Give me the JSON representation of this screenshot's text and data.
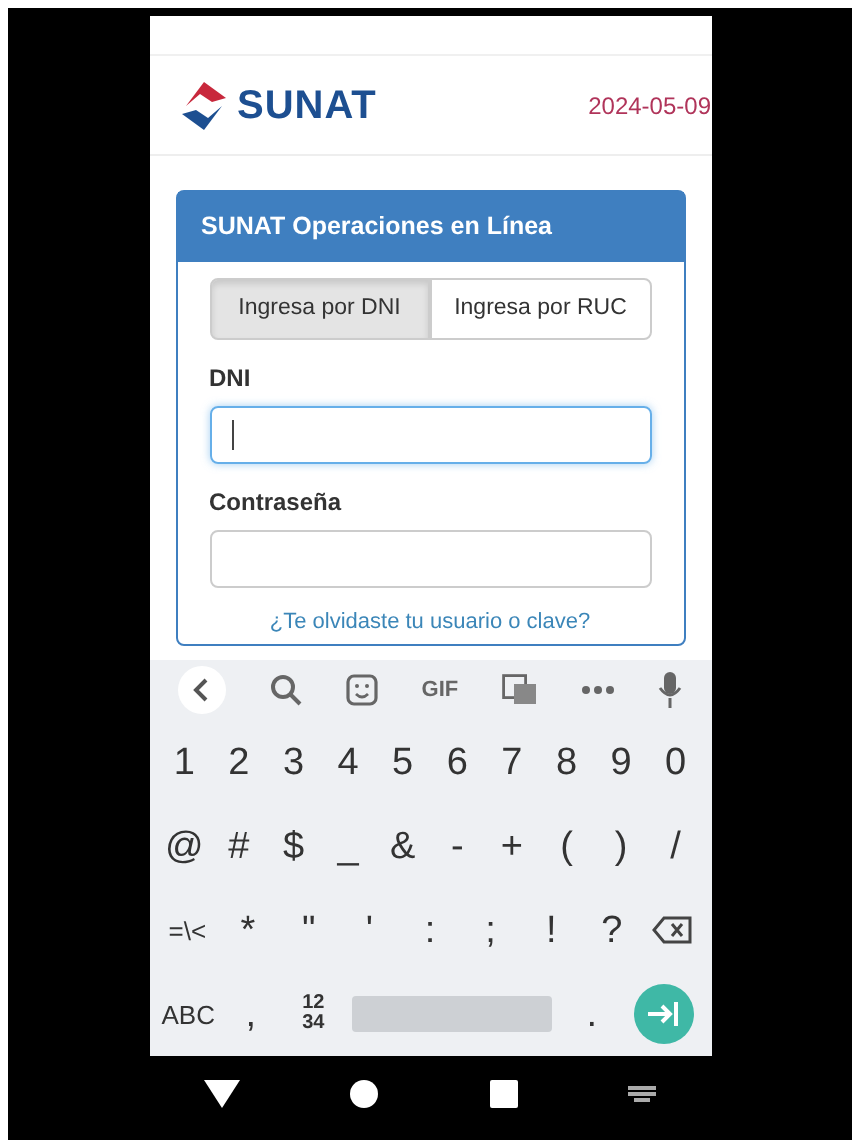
{
  "header": {
    "logo_text": "SUNAT",
    "date": "2024-05-09"
  },
  "card": {
    "title": "SUNAT Operaciones en Línea",
    "tabs": [
      {
        "label": "Ingresa por DNI",
        "selected": true
      },
      {
        "label": "Ingresa por RUC",
        "selected": false
      }
    ],
    "fields": [
      {
        "label": "DNI",
        "focused": true
      },
      {
        "label": "Contraseña",
        "focused": false
      }
    ],
    "forgot_link": "¿Te olvidaste tu usuario o clave?"
  },
  "keyboard": {
    "gif_label": "GIF",
    "rows": [
      [
        {
          "kind": "char",
          "label": "1"
        },
        {
          "kind": "char",
          "label": "2"
        },
        {
          "kind": "char",
          "label": "3"
        },
        {
          "kind": "char",
          "label": "4"
        },
        {
          "kind": "char",
          "label": "5"
        },
        {
          "kind": "char",
          "label": "6"
        },
        {
          "kind": "char",
          "label": "7"
        },
        {
          "kind": "char",
          "label": "8"
        },
        {
          "kind": "char",
          "label": "9"
        },
        {
          "kind": "char",
          "label": "0"
        }
      ],
      [
        {
          "kind": "char",
          "label": "@"
        },
        {
          "kind": "char",
          "label": "#"
        },
        {
          "kind": "char",
          "label": "$"
        },
        {
          "kind": "char",
          "label": "_"
        },
        {
          "kind": "char",
          "label": "&"
        },
        {
          "kind": "char",
          "label": "-"
        },
        {
          "kind": "char",
          "label": "+"
        },
        {
          "kind": "char",
          "label": "("
        },
        {
          "kind": "char",
          "label": ")"
        },
        {
          "kind": "char",
          "label": "/"
        }
      ],
      [
        {
          "kind": "small",
          "label": "=\\<"
        },
        {
          "kind": "char",
          "label": "*"
        },
        {
          "kind": "char",
          "label": "\""
        },
        {
          "kind": "char",
          "label": "'"
        },
        {
          "kind": "char",
          "label": ":"
        },
        {
          "kind": "char",
          "label": ";"
        },
        {
          "kind": "char",
          "label": "!"
        },
        {
          "kind": "char",
          "label": "?"
        },
        {
          "kind": "backspace"
        }
      ],
      [
        {
          "kind": "small",
          "label": "ABC"
        },
        {
          "kind": "char",
          "label": ","
        },
        {
          "kind": "stack",
          "label": "12\n34"
        },
        {
          "kind": "space"
        },
        {
          "kind": "char",
          "label": "."
        },
        {
          "kind": "enter"
        }
      ]
    ]
  }
}
